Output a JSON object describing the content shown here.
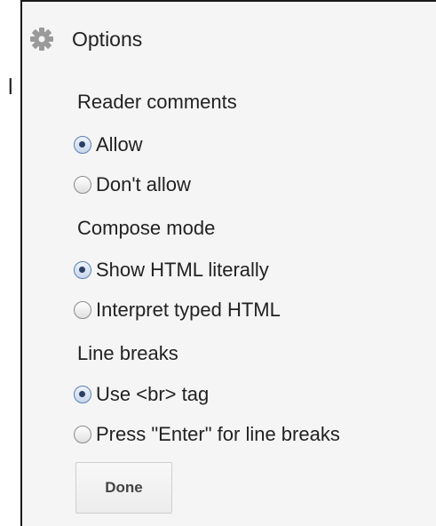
{
  "edge_text": "l",
  "panel": {
    "title": "Options",
    "icon": "gear-icon",
    "sections": [
      {
        "title": "Reader comments",
        "options": [
          {
            "label": "Allow",
            "checked": true
          },
          {
            "label": "Don't allow",
            "checked": false
          }
        ]
      },
      {
        "title": "Compose mode",
        "options": [
          {
            "label": "Show HTML literally",
            "checked": true
          },
          {
            "label": "Interpret typed HTML",
            "checked": false
          }
        ]
      },
      {
        "title": "Line breaks",
        "options": [
          {
            "label": "Use <br> tag",
            "checked": true
          },
          {
            "label": "Press \"Enter\" for line breaks",
            "checked": false
          }
        ]
      }
    ],
    "done_label": "Done"
  }
}
